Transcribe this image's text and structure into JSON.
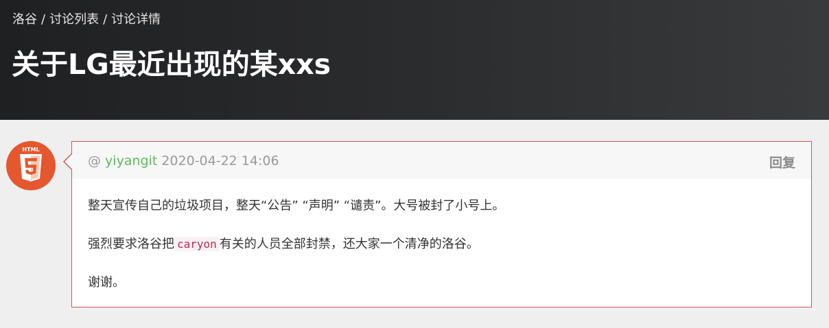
{
  "breadcrumb": {
    "items": [
      "洛谷",
      "讨论列表",
      "讨论详情"
    ],
    "separator": "/"
  },
  "page_title": "关于LG最近出现的某xxs",
  "post": {
    "at_sign": "@",
    "author": "yiyangit",
    "timestamp": "2020-04-22 14:06",
    "reply_label": "回复",
    "avatar_icon": "html5-logo-icon",
    "avatar_text": "HTML",
    "paragraphs": {
      "p1": "整天宣传自己的垃圾项目，整天“公告” “声明” “谴责”。大号被封了小号上。",
      "p2_before": "强烈要求洛谷把",
      "p2_code": "caryon",
      "p2_after": "有关的人员全部封禁，还大家一个清净的洛谷。",
      "p3": "谢谢。"
    }
  },
  "colors": {
    "header_bg": "#2b2c2e",
    "card_border": "#d0524e",
    "username": "#5eb95e",
    "avatar_bg": "#e4572f",
    "code_text": "#c7254e"
  }
}
